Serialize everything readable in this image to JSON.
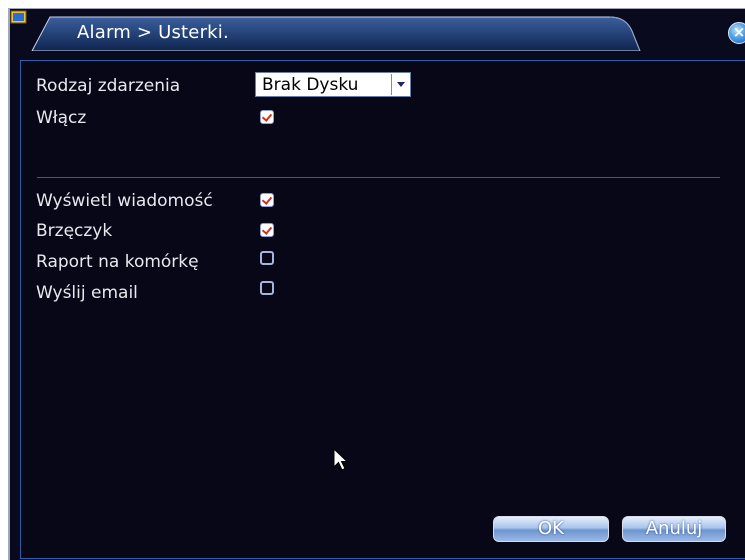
{
  "window": {
    "title": "Alarm > Usterki.",
    "close_label": "×"
  },
  "form": {
    "event_type": {
      "label": "Rodzaj zdarzenia",
      "value": "Brak Dysku"
    },
    "enable": {
      "label": "Włącz",
      "checked": true
    }
  },
  "actions": [
    {
      "label": "Wyświetl wiadomość",
      "checked": true
    },
    {
      "label": "Brzęczyk",
      "checked": true
    },
    {
      "label": "Raport na komórkę",
      "checked": false
    },
    {
      "label": "Wyślij email",
      "checked": false
    }
  ],
  "buttons": {
    "ok_label": "OK",
    "cancel_label": "Anuluj"
  },
  "colors": {
    "background": "#0a0a1e",
    "accent": "#2d5fa8",
    "check_mark": "#d03020"
  },
  "icons": {
    "title": "window-icon",
    "close": "close-icon",
    "dropdown": "chevron-down-icon",
    "pointer": "mouse-cursor-icon"
  }
}
